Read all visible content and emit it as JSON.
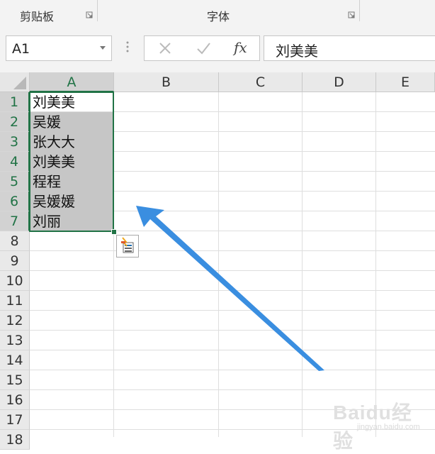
{
  "ribbon": {
    "groups": [
      {
        "label": "剪贴板"
      },
      {
        "label": "字体"
      }
    ]
  },
  "formula_bar": {
    "name_box": "A1",
    "cancel_icon": "close-icon",
    "enter_icon": "check-icon",
    "fx_label": "fx",
    "formula": "刘美美"
  },
  "grid": {
    "columns": [
      "A",
      "B",
      "C",
      "D",
      "E"
    ],
    "rows": [
      "1",
      "2",
      "3",
      "4",
      "5",
      "6",
      "7",
      "8",
      "9",
      "10",
      "11",
      "12",
      "13",
      "14",
      "15",
      "16",
      "17",
      "18"
    ],
    "selected_column": "A",
    "column_a_values": [
      "刘美美",
      "吴媛",
      "张大大",
      "刘美美",
      "程程",
      "吴媛媛",
      "刘丽"
    ],
    "selection_range": "A1:A7"
  },
  "annotation": {
    "arrow_color": "#3a8ee0",
    "arrow_icon": "arrow-pointing-up-left"
  },
  "watermark": {
    "text": "Baidu经验",
    "subtext": "jingyan.baidu.com"
  },
  "colors": {
    "selection": "#217346",
    "selected_fill": "#c6c6c6",
    "header_bg": "#e9e9e9"
  }
}
